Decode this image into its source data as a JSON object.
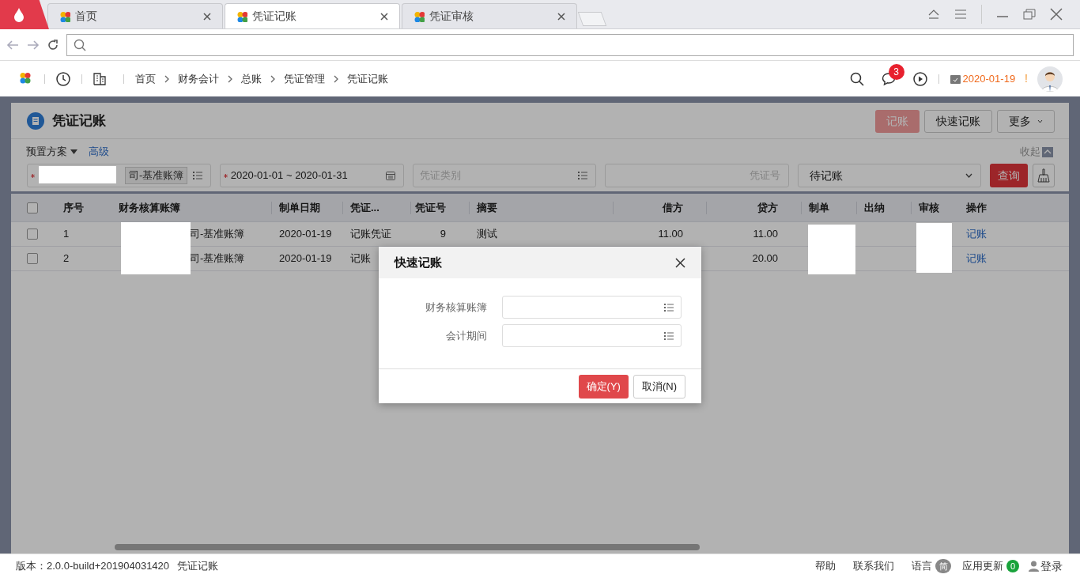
{
  "browser": {
    "tabs": [
      {
        "label": "首页",
        "selected": false
      },
      {
        "label": "凭证记账",
        "selected": true
      },
      {
        "label": "凭证审核",
        "selected": false
      }
    ]
  },
  "app_header": {
    "breadcrumbs": [
      "首页",
      "财务会计",
      "总账",
      "凭证管理",
      "凭证记账"
    ],
    "message_badge": "3",
    "date": "2020-01-19",
    "alert": "!"
  },
  "page": {
    "title": "凭证记账",
    "actions": [
      {
        "label": "记账",
        "kind": "primary",
        "disabled": true
      },
      {
        "label": "快速记账",
        "kind": "default",
        "disabled": false
      },
      {
        "label": "更多",
        "kind": "dropdown",
        "disabled": false
      }
    ],
    "filter": {
      "preset": "预置方案",
      "advanced": "高级",
      "collapse": "收起",
      "fields": [
        {
          "kind": "tag",
          "required": true,
          "value": "司-基准账簿"
        },
        {
          "kind": "date",
          "required": true,
          "value": "2020-01-01 ~ 2020-01-31"
        },
        {
          "kind": "list",
          "required": false,
          "placeholder": "凭证类别"
        },
        {
          "kind": "number",
          "required": false,
          "placeholder": "凭证号"
        },
        {
          "kind": "select",
          "required": false,
          "value": "待记账"
        }
      ],
      "query": "查询"
    }
  },
  "table": {
    "header_checked": false,
    "columns": [
      "序号",
      "财务核算账簿",
      "制单日期",
      "凭证...",
      "凭证号",
      "摘要",
      "借方",
      "贷方",
      "制单",
      "出纳",
      "审核",
      "操作"
    ],
    "rows": [
      {
        "checked": false,
        "index": "1",
        "book": "司-基准账簿",
        "date": "2020-01-19",
        "type": "记账凭证",
        "number": "9",
        "summary": "测试",
        "debit": "11.00",
        "credit": "11.00",
        "action": "记账"
      },
      {
        "checked": false,
        "index": "2",
        "book": "司-基准账簿",
        "date": "2020-01-19",
        "type": "记账",
        "credit": "20.00",
        "action": "记账"
      }
    ]
  },
  "dialog": {
    "title": "快速记账",
    "fields": [
      {
        "label": "财务核算账簿"
      },
      {
        "label": "会计期间"
      }
    ],
    "buttons": [
      {
        "label": "确定(Y)",
        "kind": "primary"
      },
      {
        "label": "取消(N)",
        "kind": "default"
      }
    ]
  },
  "status_bar": {
    "version": "版本：2.0.0-build+201904031420",
    "page": "凭证记账",
    "links": [
      "帮助",
      "联系我们"
    ],
    "language": "语言",
    "language_badge": "简",
    "updates": "应用更新",
    "updates_badge": "0",
    "login": "登录"
  }
}
